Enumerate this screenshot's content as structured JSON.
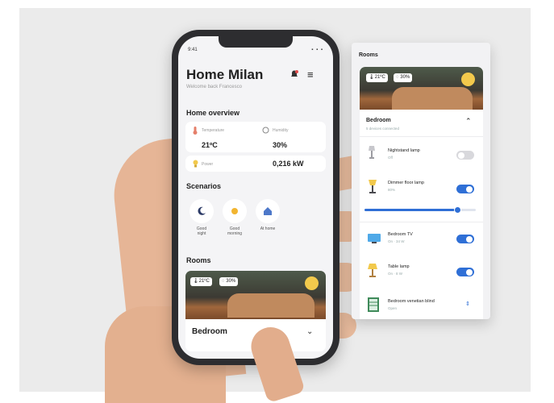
{
  "phone": {
    "status_time": "9:41",
    "status_icons": "▪ ▪ ▪",
    "home_title": "Home Milan",
    "home_subtitle": "Welcome back Francesco",
    "overview_title": "Home overview",
    "overview": {
      "temperature_label": "Temperature",
      "temperature_value": "21ºC",
      "humidity_label": "Humidity",
      "humidity_value": "30%",
      "power_label": "Power",
      "power_value": "0,216 kW"
    },
    "scenarios_title": "Scenarios",
    "scenarios": [
      {
        "label_line1": "Good",
        "label_line2": "night",
        "icon": "moon-icon"
      },
      {
        "label_line1": "Good",
        "label_line2": "morning",
        "icon": "sun-icon"
      },
      {
        "label_line1": "At home",
        "label_line2": "",
        "icon": "home-icon"
      }
    ],
    "rooms_title": "Rooms",
    "room_card": {
      "temperature": "21ºC",
      "humidity": "30%",
      "name": "Bedroom"
    }
  },
  "panel": {
    "title": "Rooms",
    "room_card": {
      "temperature": "21ºC",
      "humidity": "30%",
      "name": "Bedroom",
      "subtitle": "5 devices connected"
    },
    "devices": [
      {
        "name": "Nightstand lamp",
        "sub": "Off",
        "on": false,
        "icon": "lamp-icon"
      },
      {
        "name": "Dimmer floor lamp",
        "sub": "80%",
        "on": true,
        "icon": "floor-lamp-icon",
        "dimmer_level": 0.84
      },
      {
        "name": "Bedroom TV",
        "sub": "On · 34 W",
        "on": true,
        "icon": "tv-icon"
      },
      {
        "name": "Table lamp",
        "sub": "On · 8 W",
        "on": true,
        "icon": "table-lamp-icon"
      },
      {
        "name": "Bedroom venetian blind",
        "sub": "Open",
        "on": null,
        "icon": "blind-icon"
      }
    ]
  },
  "colors": {
    "accent": "#2f6fd6",
    "sun": "#f2c94c",
    "background": "#ebebeb"
  }
}
